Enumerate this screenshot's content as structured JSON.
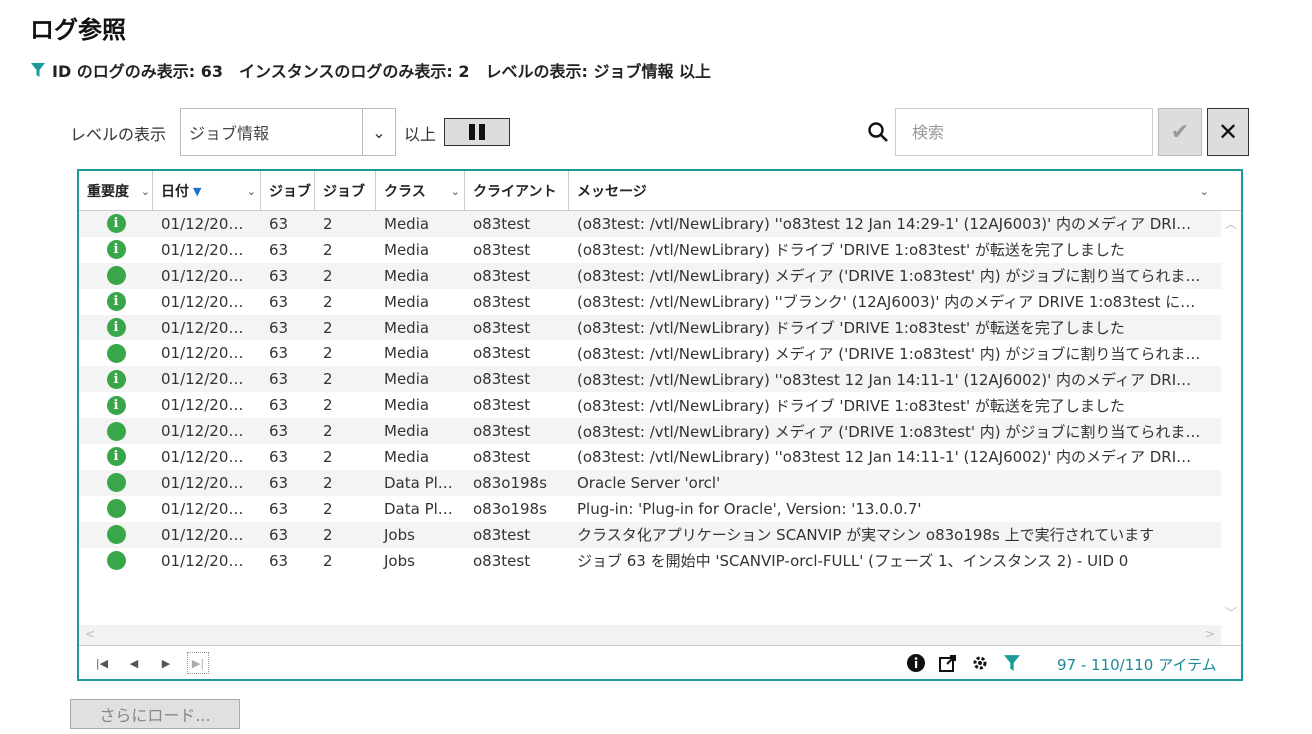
{
  "page": {
    "title": "ログ参照",
    "filter_summary": {
      "id_filter": "ID のログのみ表示: 63",
      "instance_filter": "インスタンスのログのみ表示: 2",
      "level_filter": "レベルの表示: ジョブ情報 以上"
    }
  },
  "toolbar": {
    "level_label": "レベルの表示",
    "level_value": "ジョブ情報",
    "level_suffix": "以上",
    "search_placeholder": "検索"
  },
  "grid": {
    "columns": [
      {
        "key": "severity",
        "label": "重要度"
      },
      {
        "key": "date",
        "label": "日付"
      },
      {
        "key": "job",
        "label": "ジョブ"
      },
      {
        "key": "job_instance",
        "label": "ジョブ"
      },
      {
        "key": "class",
        "label": "クラス"
      },
      {
        "key": "client",
        "label": "クライアント"
      },
      {
        "key": "message",
        "label": "メッセージ"
      }
    ],
    "rows": [
      {
        "sev": "info",
        "date": "01/12/20…",
        "job": "63",
        "inst": "2",
        "cls": "Media",
        "cli": "o83test",
        "msg": "(o83test: /vtl/NewLibrary) ''o83test 12 Jan 14:29-1' (12AJ6003)' 内のメディア DRI…"
      },
      {
        "sev": "info",
        "date": "01/12/20…",
        "job": "63",
        "inst": "2",
        "cls": "Media",
        "cli": "o83test",
        "msg": "(o83test: /vtl/NewLibrary) ドライブ 'DRIVE 1:o83test' が転送を完了しました"
      },
      {
        "sev": "ok",
        "date": "01/12/20…",
        "job": "63",
        "inst": "2",
        "cls": "Media",
        "cli": "o83test",
        "msg": "(o83test: /vtl/NewLibrary) メディア ('DRIVE 1:o83test' 内) がジョブに割り当てられま…"
      },
      {
        "sev": "info",
        "date": "01/12/20…",
        "job": "63",
        "inst": "2",
        "cls": "Media",
        "cli": "o83test",
        "msg": "(o83test: /vtl/NewLibrary) ''ブランク' (12AJ6003)' 内のメディア DRIVE 1:o83test に…"
      },
      {
        "sev": "info",
        "date": "01/12/20…",
        "job": "63",
        "inst": "2",
        "cls": "Media",
        "cli": "o83test",
        "msg": "(o83test: /vtl/NewLibrary) ドライブ 'DRIVE 1:o83test' が転送を完了しました"
      },
      {
        "sev": "ok",
        "date": "01/12/20…",
        "job": "63",
        "inst": "2",
        "cls": "Media",
        "cli": "o83test",
        "msg": "(o83test: /vtl/NewLibrary) メディア ('DRIVE 1:o83test' 内) がジョブに割り当てられま…"
      },
      {
        "sev": "info",
        "date": "01/12/20…",
        "job": "63",
        "inst": "2",
        "cls": "Media",
        "cli": "o83test",
        "msg": "(o83test: /vtl/NewLibrary) ''o83test 12 Jan 14:11-1' (12AJ6002)' 内のメディア DRI…"
      },
      {
        "sev": "info",
        "date": "01/12/20…",
        "job": "63",
        "inst": "2",
        "cls": "Media",
        "cli": "o83test",
        "msg": "(o83test: /vtl/NewLibrary) ドライブ 'DRIVE 1:o83test' が転送を完了しました"
      },
      {
        "sev": "ok",
        "date": "01/12/20…",
        "job": "63",
        "inst": "2",
        "cls": "Media",
        "cli": "o83test",
        "msg": "(o83test: /vtl/NewLibrary) メディア ('DRIVE 1:o83test' 内) がジョブに割り当てられま…"
      },
      {
        "sev": "info",
        "date": "01/12/20…",
        "job": "63",
        "inst": "2",
        "cls": "Media",
        "cli": "o83test",
        "msg": "(o83test: /vtl/NewLibrary) ''o83test 12 Jan 14:11-1' (12AJ6002)' 内のメディア DRI…"
      },
      {
        "sev": "ok",
        "date": "01/12/20…",
        "job": "63",
        "inst": "2",
        "cls": "Data Pl…",
        "cli": "o83o198s",
        "msg": "Oracle Server 'orcl'"
      },
      {
        "sev": "ok",
        "date": "01/12/20…",
        "job": "63",
        "inst": "2",
        "cls": "Data Pl…",
        "cli": "o83o198s",
        "msg": "Plug-in: 'Plug-in for Oracle', Version: '13.0.0.7'"
      },
      {
        "sev": "ok",
        "date": "01/12/20…",
        "job": "63",
        "inst": "2",
        "cls": "Jobs",
        "cli": "o83test",
        "msg": "クラスタ化アプリケーション SCANVIP が実マシン o83o198s 上で実行されています"
      },
      {
        "sev": "ok",
        "date": "01/12/20…",
        "job": "63",
        "inst": "2",
        "cls": "Jobs",
        "cli": "o83test",
        "msg": "ジョブ 63 を開始中 'SCANVIP-orcl-FULL' (フェーズ 1、インスタンス 2) - UID 0"
      }
    ],
    "range_text": "97 - 110/110 アイテム"
  },
  "load_more_label": "さらにロード...",
  "colors": {
    "accent": "#1a9a9a",
    "status_green": "#3aa64a"
  }
}
